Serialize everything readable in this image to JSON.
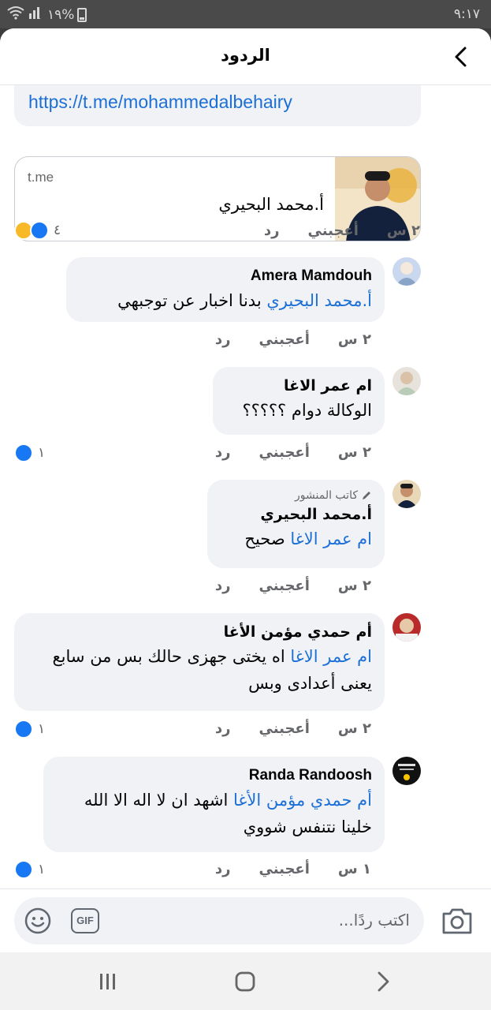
{
  "status_bar": {
    "time": "٩:١٧",
    "battery": "%١٩"
  },
  "header": {
    "title": "الردود"
  },
  "link_preview": {
    "url": "https://t.me/mohammedalbehairy",
    "domain": "t.me",
    "title": "أ.محمد البحيري",
    "time": "٢ س",
    "like": "أعجبني",
    "reply": "رد",
    "reaction_count": "٤"
  },
  "comments": [
    {
      "name": "Amera Mamdouh",
      "mention": "أ.محمد البحيري",
      "text": "بدنا اخبار عن توجبهي",
      "time": "٢ س",
      "like": "أعجبني",
      "reply": "رد",
      "reaction_count": ""
    },
    {
      "name": "ام عمر الاغا",
      "mention": "",
      "text": "الوكالة دوام ؟؟؟؟؟",
      "time": "٢ س",
      "like": "أعجبني",
      "reply": "رد",
      "reaction_count": "١"
    },
    {
      "tag": "كاتب المنشور",
      "name": "أ.محمد البحيري",
      "mention": "ام عمر الاغا",
      "text": "صحيح",
      "time": "٢ س",
      "like": "أعجبني",
      "reply": "رد",
      "reaction_count": ""
    },
    {
      "name": "أم حمدي مؤمن الأغا",
      "mention": "ام عمر الاغا",
      "text": "اه يختى جهزى حالك بس من سابع يعنى أعدادى وبس",
      "time": "٢ س",
      "like": "أعجبني",
      "reply": "رد",
      "reaction_count": "١"
    },
    {
      "name": "Randa Randoosh",
      "mention": "أم حمدي مؤمن الأغا",
      "text": "اشهد ان لا اله الا الله خلينا نتنفس شووي",
      "time": "١ س",
      "like": "أعجبني",
      "reply": "رد",
      "reaction_count": "١"
    }
  ],
  "composer": {
    "placeholder": "اكتب ردًا...",
    "gif_label": "GIF"
  },
  "colors": {
    "link": "#1c6fd6",
    "bubble": "#f0f2f5",
    "like_blue": "#1877f2"
  }
}
